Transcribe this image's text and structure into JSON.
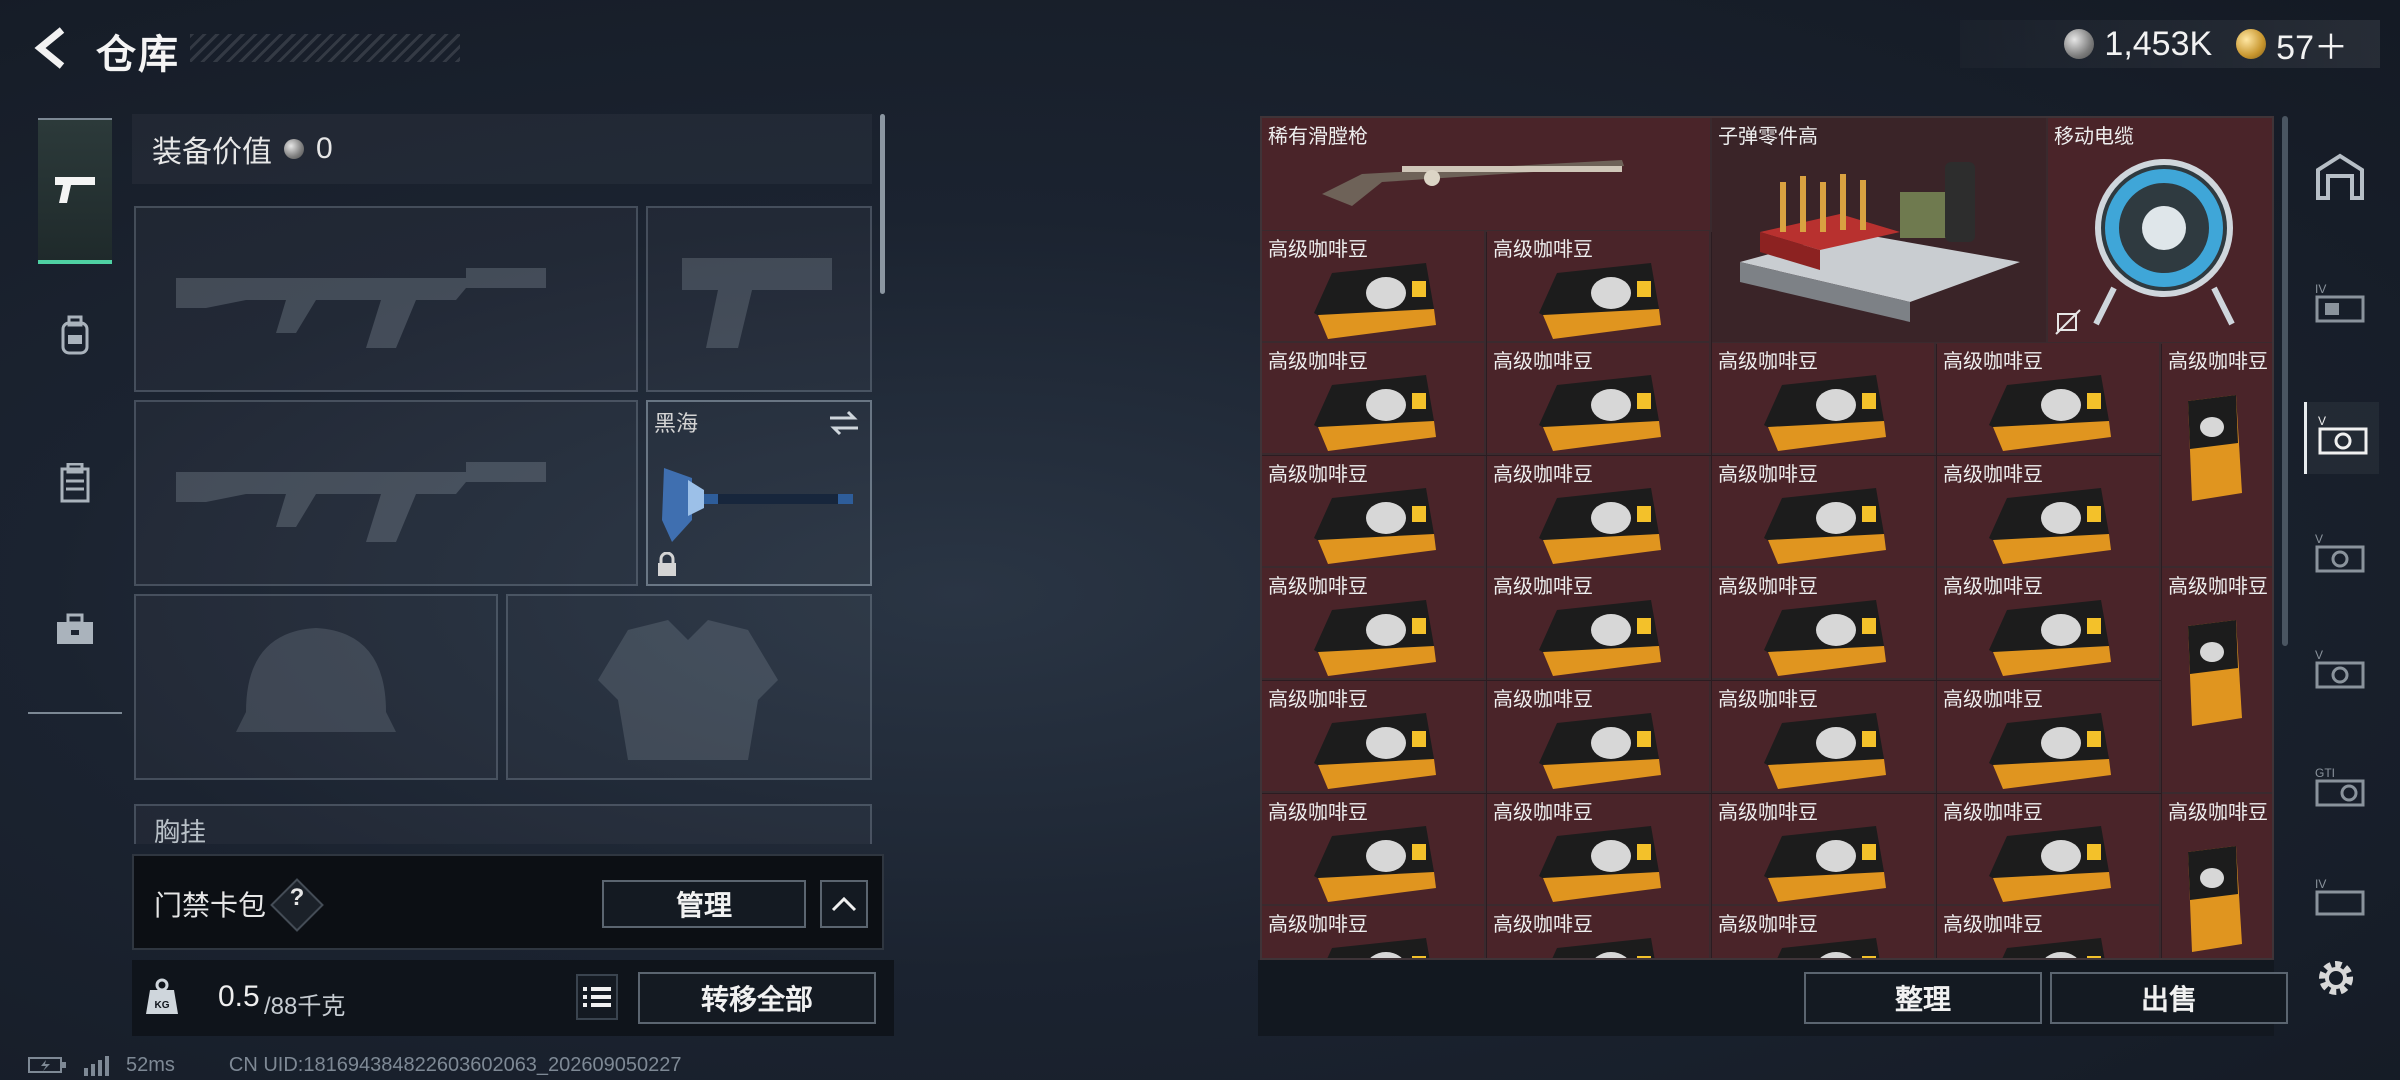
{
  "header": {
    "back_icon": "back-arrow-icon",
    "title": "仓库"
  },
  "currency": {
    "silver": "1,453K",
    "gold": "57＋"
  },
  "left_tabs": [
    "pistol-icon",
    "backpack-icon",
    "vest-icon",
    "toolbox-icon"
  ],
  "equipment": {
    "value_label": "装备价值",
    "value": "0",
    "melee_name": "黑海",
    "next_section_label": "胸挂"
  },
  "keycard": {
    "label": "门禁卡包",
    "help": "?",
    "manage_button": "管理",
    "collapse_icon": "chevron-up-icon"
  },
  "weight": {
    "current": "0.5",
    "max": "/88千克",
    "transfer_all": "转移全部"
  },
  "storage": {
    "items": [
      {
        "name": "稀有滑膛枪"
      },
      {
        "name": "子弹零件高"
      },
      {
        "name": "移动电缆"
      },
      {
        "name": "高级咖啡豆"
      }
    ],
    "sort_button": "整理",
    "sell_button": "出售"
  },
  "status": {
    "ping": "52ms",
    "uid": "CN UID:181694384822603602063_202609050227"
  },
  "colors": {
    "grid_cell": "#4a2429",
    "accent_green": "#4fd1a3"
  }
}
